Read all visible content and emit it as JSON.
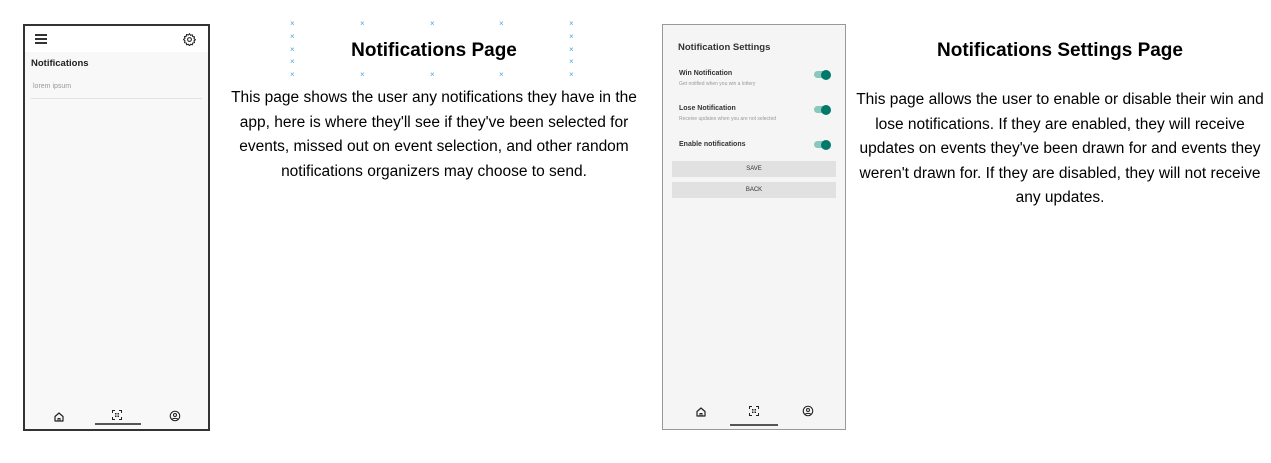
{
  "notifications_page": {
    "screen_title": "Notifications",
    "items": [
      "lorem ipsum"
    ],
    "heading": "Notifications Page",
    "description": "This page shows the user any notifications they have in the app, here is where they'll see if they've been selected for events, missed out on event selection, and other random notifications organizers may choose to send."
  },
  "settings_page": {
    "screen_title": "Notification Settings",
    "settings": [
      {
        "label": "Win Notification",
        "sublabel": "Get notified when you win a lottery",
        "enabled": true
      },
      {
        "label": "Lose Notification",
        "sublabel": "Receive updates when you are not selected",
        "enabled": true
      },
      {
        "label": "Enable notifications",
        "sublabel": "",
        "enabled": true
      }
    ],
    "save_label": "SAVE",
    "back_label": "BACK",
    "heading": "Notifications Settings Page",
    "description": "This page allows the user to enable or disable their win and lose notifications. If they are enabled, they will receive updates on events they've been drawn for and events they weren't drawn for. If they are disabled, they will not receive any updates."
  },
  "colors": {
    "toggle_on": "#00796b",
    "toggle_track": "#8ac7bd",
    "button_bg": "#e1e1e1"
  },
  "icons": [
    "menu-icon",
    "gear-icon",
    "home-icon",
    "qr-scan-icon",
    "profile-icon"
  ]
}
